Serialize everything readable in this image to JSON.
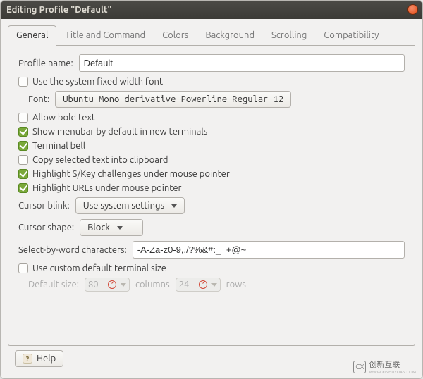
{
  "window": {
    "title": "Editing Profile \"Default\""
  },
  "tabs": [
    {
      "label": "General",
      "active": true
    },
    {
      "label": "Title and Command",
      "active": false
    },
    {
      "label": "Colors",
      "active": false
    },
    {
      "label": "Background",
      "active": false
    },
    {
      "label": "Scrolling",
      "active": false
    },
    {
      "label": "Compatibility",
      "active": false
    }
  ],
  "general": {
    "profile_name_label": "Profile name:",
    "profile_name_value": "Default",
    "use_system_font": {
      "checked": false,
      "label": "Use the system fixed width font"
    },
    "font_label": "Font:",
    "font_value": "Ubuntu Mono derivative Powerline Regular  12",
    "allow_bold": {
      "checked": false,
      "label": "Allow bold text"
    },
    "show_menubar": {
      "checked": true,
      "label": "Show menubar by default in new terminals"
    },
    "terminal_bell": {
      "checked": true,
      "label": "Terminal bell"
    },
    "copy_selected": {
      "checked": false,
      "label": "Copy selected text into clipboard"
    },
    "highlight_skey": {
      "checked": true,
      "label": "Highlight S/Key challenges under mouse pointer"
    },
    "highlight_urls": {
      "checked": true,
      "label": "Highlight URLs under mouse pointer"
    },
    "cursor_blink_label": "Cursor blink:",
    "cursor_blink_value": "Use system settings",
    "cursor_shape_label": "Cursor shape:",
    "cursor_shape_value": "Block",
    "select_by_word_label": "Select-by-word characters:",
    "select_by_word_value": "-A-Za-z0-9,./?%&#:_=+@~",
    "use_custom_size": {
      "checked": false,
      "label": "Use custom default terminal size"
    },
    "default_size_label": "Default size:",
    "cols_value": "80",
    "cols_unit": "columns",
    "rows_value": "24",
    "rows_unit": "rows"
  },
  "footer": {
    "help_label": "Help"
  },
  "watermark": {
    "text": "创新互联",
    "sub": "WWW.XINHUYUAN.COM",
    "logo": "CX"
  }
}
